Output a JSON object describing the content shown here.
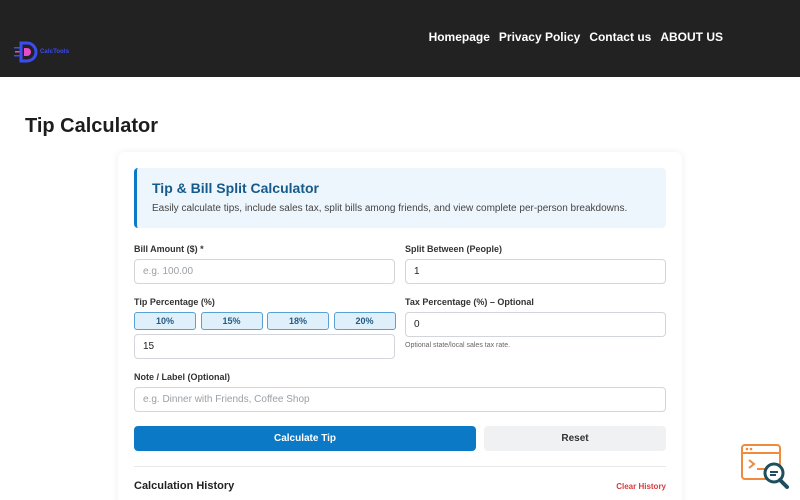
{
  "header": {
    "logo_text": "CalcTools",
    "nav": [
      "Homepage",
      "Privacy Policy",
      "Contact us",
      "ABOUT US"
    ]
  },
  "page": {
    "title": "Tip Calculator"
  },
  "intro": {
    "title": "Tip & Bill Split Calculator",
    "description": "Easily calculate tips, include sales tax, split bills among friends, and view complete per-person breakdowns."
  },
  "form": {
    "bill": {
      "label": "Bill Amount ($) *",
      "placeholder": "e.g. 100.00",
      "value": ""
    },
    "split": {
      "label": "Split Between (People)",
      "value": "1"
    },
    "tip": {
      "label": "Tip Percentage (%)",
      "presets": [
        "10%",
        "15%",
        "18%",
        "20%"
      ],
      "value": "15"
    },
    "tax": {
      "label": "Tax Percentage (%) – Optional",
      "value": "0",
      "hint": "Optional state/local sales tax rate."
    },
    "note": {
      "label": "Note / Label (Optional)",
      "placeholder": "e.g. Dinner with Friends, Coffee Shop",
      "value": ""
    },
    "calculate_label": "Calculate Tip",
    "reset_label": "Reset"
  },
  "history": {
    "title": "Calculation History",
    "clear_label": "Clear History"
  },
  "colors": {
    "header_bg": "#222222",
    "primary": "#0b79c6",
    "intro_bg": "#eef6fd",
    "danger": "#d83b3b"
  }
}
